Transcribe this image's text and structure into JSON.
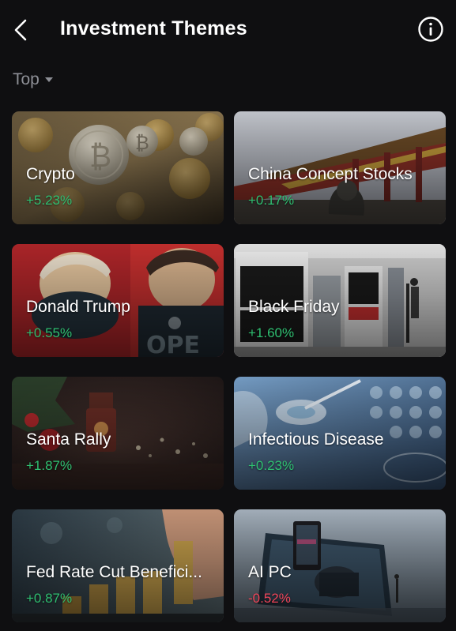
{
  "header": {
    "title": "Investment Themes",
    "back_icon": "chevron-left-icon",
    "info_icon": "info-circle-icon"
  },
  "sort": {
    "label": "Top",
    "icon": "caret-down-icon"
  },
  "colors": {
    "background": "#0f0f11",
    "positive": "#2fbf71",
    "negative": "#f0455a",
    "muted": "#8d8f96"
  },
  "themes": [
    {
      "name": "Crypto",
      "change": "+5.23%",
      "direction": "up"
    },
    {
      "name": "China Concept Stocks",
      "change": "+0.17%",
      "direction": "up"
    },
    {
      "name": "Donald Trump",
      "change": "+0.55%",
      "direction": "up"
    },
    {
      "name": "Black Friday",
      "change": "+1.60%",
      "direction": "up"
    },
    {
      "name": "Santa Rally",
      "change": "+1.87%",
      "direction": "up"
    },
    {
      "name": "Infectious Disease",
      "change": "+0.23%",
      "direction": "up"
    },
    {
      "name": "Fed Rate Cut Benefici...",
      "change": "+0.87%",
      "direction": "up"
    },
    {
      "name": "AI PC",
      "change": "-0.52%",
      "direction": "down"
    }
  ]
}
